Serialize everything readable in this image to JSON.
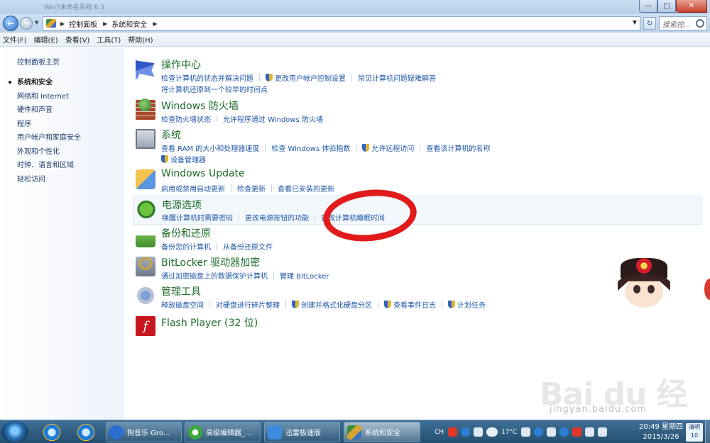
{
  "window": {
    "title": "Win7未命名系统 6.3",
    "min_glyph": "—",
    "max_glyph": "□",
    "close_glyph": "✕"
  },
  "nav": {
    "back_glyph": "←",
    "fwd_glyph": "→",
    "drop_glyph": "▼",
    "crumb_sep": "▶",
    "breadcrumbs": [
      "控制面板",
      "系统和安全"
    ],
    "address_drop_glyph": "▼",
    "refresh_glyph": "↻",
    "search_placeholder": "搜索控..."
  },
  "menubar": {
    "items": [
      "文件(F)",
      "编辑(E)",
      "查看(V)",
      "工具(T)",
      "帮助(H)"
    ]
  },
  "left_pane": {
    "home": "控制面板主页",
    "items": [
      "系统和安全",
      "网络和 Internet",
      "硬件和声音",
      "程序",
      "用户帐户和家庭安全",
      "外观和个性化",
      "时钟、语言和区域",
      "轻松访问"
    ],
    "current_index": 0
  },
  "sections": [
    {
      "title": "操作中心",
      "links": [
        "检查计算机的状态并解决问题",
        "更改用户帐户控制设置",
        "常见计算机问题疑难解答"
      ],
      "links2": [
        "将计算机还原到一个较早的时间点"
      ]
    },
    {
      "title": "Windows 防火墙",
      "links": [
        "检查防火墙状态",
        "允许程序通过 Windows 防火墙"
      ]
    },
    {
      "title": "系统",
      "links": [
        "查看 RAM 的大小和处理器速度",
        "检查 Windows 体验指数",
        "允许远程访问",
        "查看该计算机的名称"
      ],
      "links2": [
        "设备管理器"
      ]
    },
    {
      "title": "Windows Update",
      "links": [
        "启用或禁用自动更新",
        "检查更新",
        "查看已安装的更新"
      ]
    },
    {
      "title": "电源选项",
      "links": [
        "唤醒计算机时需要密码",
        "更改电源按钮的功能",
        "更改计算机睡眠时间"
      ]
    },
    {
      "title": "备份和还原",
      "links": [
        "备份您的计算机",
        "从备份还原文件"
      ]
    },
    {
      "title": "BitLocker 驱动器加密",
      "links": [
        "通过加密磁盘上的数据保护计算机",
        "管理 BitLocker"
      ]
    },
    {
      "title": "管理工具",
      "links": [
        "释放磁盘空间",
        "对硬盘进行碎片整理",
        "创建并格式化硬盘分区",
        "查看事件日志",
        "计划任务"
      ]
    },
    {
      "title": "Flash Player (32 位)",
      "links": []
    }
  ],
  "icons": {
    "flash_glyph": "f"
  },
  "watermark": {
    "logo": "Bai du 经验",
    "url": "jingyan.baidu.com"
  },
  "taskbar": {
    "tasks": [
      "狗音乐 Gro...",
      "高级编辑器_...",
      "迅雷极速版",
      "系统和安全"
    ],
    "tray_lang": "CH",
    "temperature": "17°C",
    "time": "20:49 星期四",
    "date": "2015/3/26",
    "weather_label": "清明",
    "weather_day": "10"
  },
  "colors": {
    "section_title": "#1e6b2b",
    "link": "#1f56a8",
    "annotation": "#e11b1b"
  }
}
